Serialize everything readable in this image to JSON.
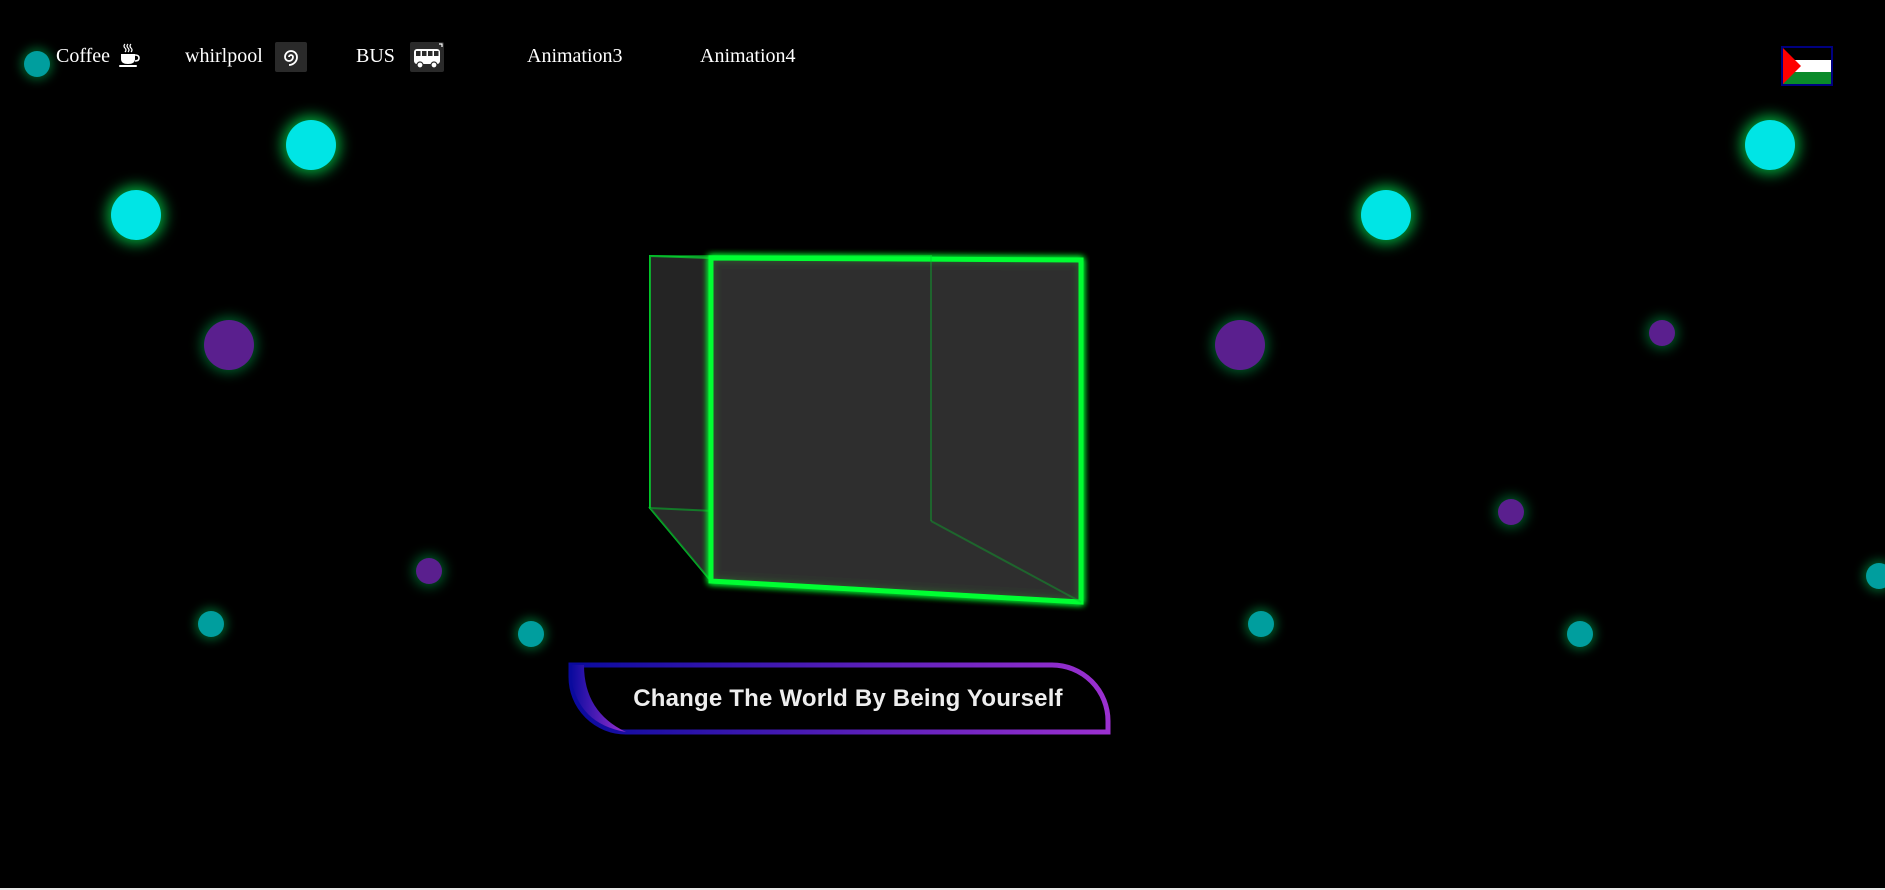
{
  "nav": {
    "items": [
      {
        "label": "Coffee",
        "icon": "coffee-cup-icon"
      },
      {
        "label": "whirlpool",
        "icon": "whirlpool-icon"
      },
      {
        "label": "BUS",
        "icon": "bus-icon"
      },
      {
        "label": "Animation3"
      },
      {
        "label": "Animation4"
      }
    ],
    "flag_icon": "palestine-flag-icon"
  },
  "slogan": {
    "text": "Change The World By Being Yourself"
  },
  "colors": {
    "background": "#000000",
    "cube_edge": "#00ff33",
    "cube_face": "#2e2e2e",
    "bubble_cyan": "#00e5e5",
    "bubble_teal": "#009e9e",
    "bubble_purple": "#5a1f8e",
    "slogan_gradient_start": "#0a0a9e",
    "slogan_gradient_end": "#9b30d0",
    "flag_black": "#000000",
    "flag_white": "#ffffff",
    "flag_green": "#0a8a2a",
    "flag_red": "#ff0000"
  }
}
